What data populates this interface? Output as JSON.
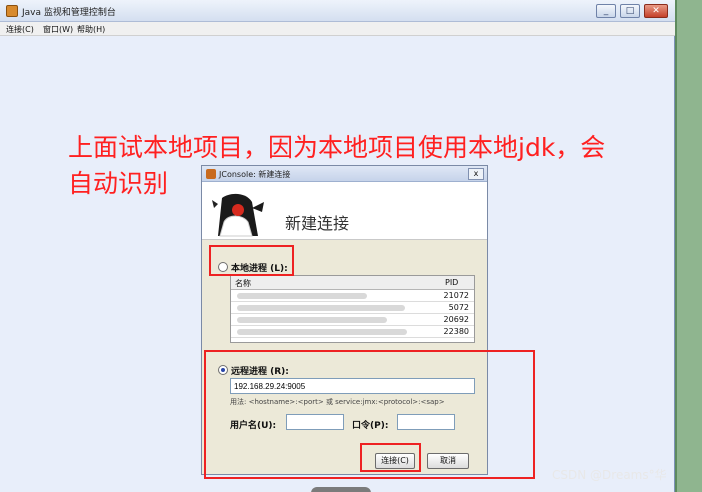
{
  "main_window": {
    "title": "Java 监视和管理控制台",
    "menu": [
      "连接(C)",
      "窗口(W)",
      "帮助(H)"
    ],
    "controls": [
      "_",
      "□",
      "✕"
    ]
  },
  "annotation": {
    "line1": "上面试本地项目，因为本地项目使用本地jdk，会",
    "line2": "自动识别"
  },
  "dialog": {
    "title": "JConsole: 新建连接",
    "close": "x",
    "heading": "新建连接",
    "local": {
      "label": "本地进程 (L):",
      "selected": false,
      "columns": [
        "名称",
        "PID"
      ],
      "rows": [
        {
          "pid": "21072"
        },
        {
          "pid": "5072"
        },
        {
          "pid": "20692"
        },
        {
          "pid": "22380"
        }
      ]
    },
    "remote": {
      "label": "远程进程 (R):",
      "selected": true,
      "address": "192.168.29.24:9005",
      "usage": "用法: <hostname>:<port> 或 service:jmx:<protocol>:<sap>",
      "username_label": "用户名(U):",
      "password_label": "口令(P):",
      "username_value": "",
      "password_value": ""
    },
    "connect_button": "连接(C)",
    "cancel_button": "取消"
  },
  "watermark": "CSDN @Dreams°华",
  "colors": {
    "annotation": "#ff2020",
    "highlight_box": "#ee2222",
    "dialog_bg": "#ece9d8",
    "window_bg": "#e8eefa"
  }
}
